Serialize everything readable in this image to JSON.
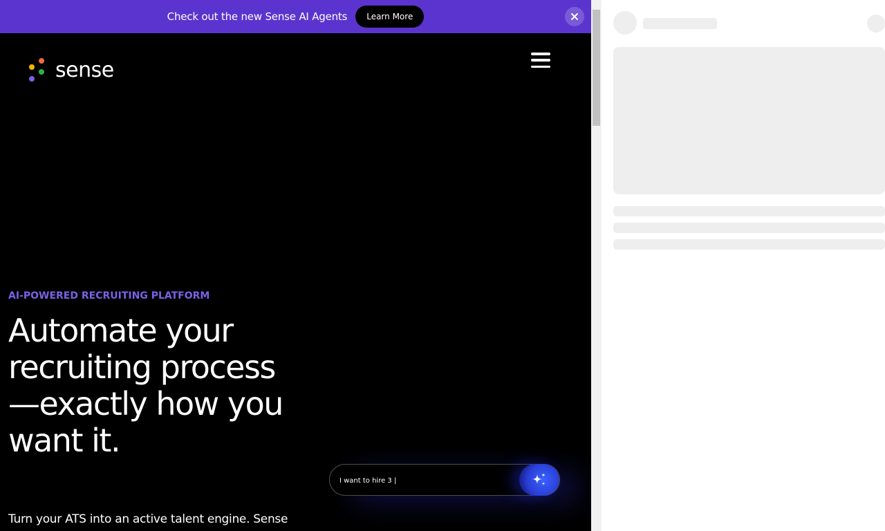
{
  "banner": {
    "text": "Check out the new Sense AI Agents",
    "button_label": "Learn More",
    "close_symbol": "✕",
    "background": "#5b34cf"
  },
  "header": {
    "logo_text": "sense",
    "logo_dot_colors": [
      "#f26b38",
      "#f5b400",
      "#2bb24c",
      "#7b61e6"
    ],
    "menu_icon": "hamburger-icon"
  },
  "hero": {
    "eyebrow": "AI-POWERED RECRUITING PLATFORM",
    "title": "Automate your recruiting process—exactly how you want it.",
    "subtitle": "Turn your ATS into an active talent engine. Sense",
    "accent": "#7b61e6"
  },
  "prompt": {
    "value": "I want to hire 3 |",
    "button_icon": "sparkle-icon"
  }
}
